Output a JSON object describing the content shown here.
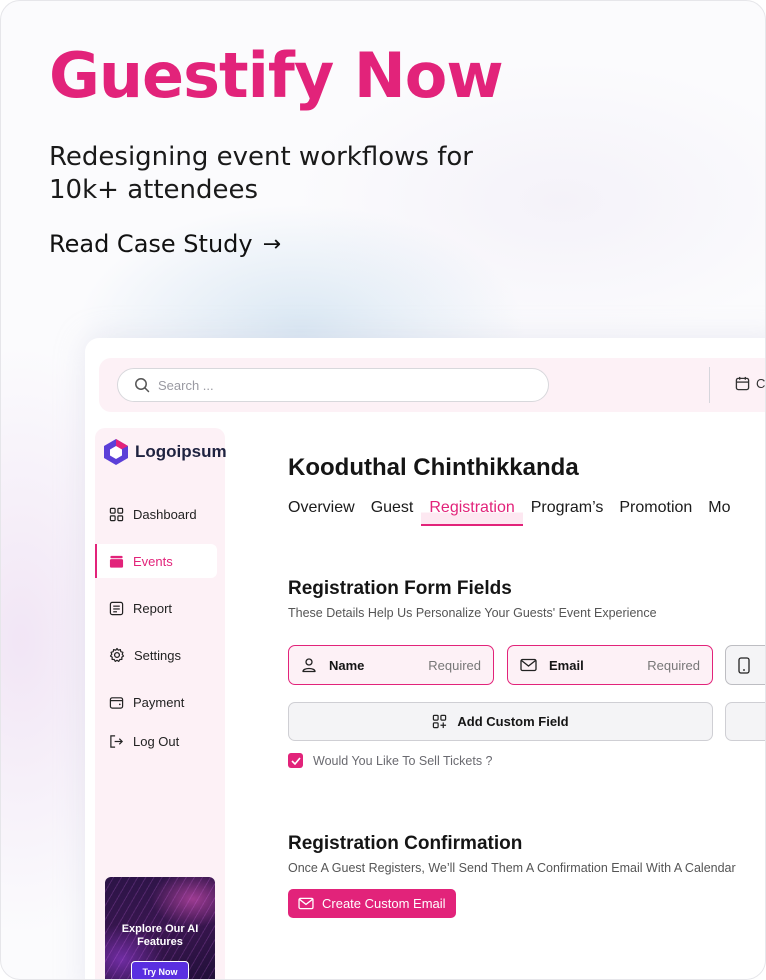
{
  "hero": {
    "brand": "Guestify Now",
    "tagline": "Redesigning event workflows for 10k+ attendees",
    "cta": "Read Case Study",
    "cta_arrow": "→"
  },
  "app": {
    "search": {
      "placeholder": "Search ..."
    },
    "date_chip": "C",
    "logo": "Logoipsum",
    "nav": [
      {
        "label": "Dashboard",
        "icon": "grid-icon"
      },
      {
        "label": "Events",
        "icon": "folder-icon",
        "active": true
      },
      {
        "label": "Report",
        "icon": "report-icon"
      },
      {
        "label": "Settings",
        "icon": "gear-icon"
      },
      {
        "label": "Payment",
        "icon": "wallet-icon"
      },
      {
        "label": "Log Out",
        "icon": "logout-icon"
      }
    ],
    "promo": {
      "title": "Explore Our AI Features",
      "button": "Try Now"
    },
    "event_title": "Kooduthal Chinthikkanda",
    "tabs": [
      "Overview",
      "Guest",
      "Registration",
      "Program’s",
      "Promotion",
      "Mo"
    ],
    "active_tab": "Registration",
    "form_fields": {
      "title": "Registration Form Fields",
      "subtitle": "These Details Help Us Personalize Your Guests' Event Experience",
      "fields": [
        {
          "label": "Name",
          "status": "Required",
          "icon": "user-icon"
        },
        {
          "label": "Email",
          "status": "Required",
          "icon": "mail-icon"
        }
      ],
      "add_custom": "Add Custom Field",
      "sell_tickets": "Would You Like To Sell Tickets ?"
    },
    "confirmation": {
      "title": "Registration Confirmation",
      "subtitle": "Once A Guest Registers, We’ll Send Them A Confirmation Email With A Calendar",
      "button": "Create Custom Email"
    }
  },
  "colors": {
    "accent": "#e2237a",
    "tint": "#fdf1f6"
  }
}
